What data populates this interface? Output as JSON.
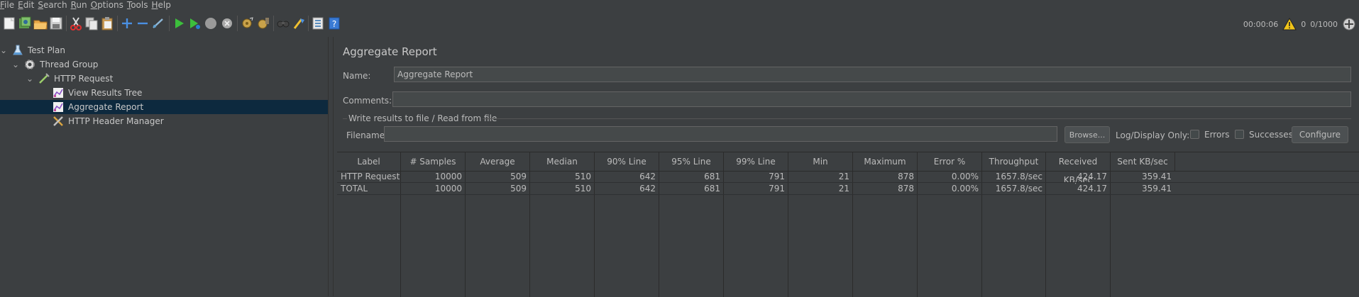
{
  "menu": [
    {
      "u": "F",
      "rest": "ile"
    },
    {
      "u": "E",
      "rest": "dit"
    },
    {
      "u": "S",
      "rest": "earch"
    },
    {
      "u": "R",
      "rest": "un"
    },
    {
      "u": "O",
      "rest": "ptions"
    },
    {
      "u": "T",
      "rest": "ools"
    },
    {
      "u": "H",
      "rest": "elp"
    }
  ],
  "toolbar_icons": [
    "new-icon",
    "templates-icon",
    "open-icon",
    "save-icon",
    "cut-icon",
    "copy-icon",
    "paste-icon",
    "expand-icon",
    "collapse-icon",
    "toggle-icon",
    "start-icon",
    "start-no-pauses-icon",
    "stop-icon",
    "shutdown-icon",
    "clear-icon",
    "clear-all-icon",
    "search-icon",
    "reset-search-icon",
    "function-helper-icon",
    "help-icon"
  ],
  "status": {
    "elapsed": "00:00:06",
    "warnings": "0",
    "threads": "0/1000"
  },
  "tree": [
    {
      "label": "Test Plan",
      "icon": "flask-icon",
      "caret": "v"
    },
    {
      "label": "Thread Group",
      "icon": "gear-icon",
      "caret": "v"
    },
    {
      "label": "HTTP Request",
      "icon": "pipette-icon",
      "caret": "v"
    },
    {
      "label": "View Results Tree",
      "icon": "chart-icon",
      "caret": ""
    },
    {
      "label": "Aggregate Report",
      "icon": "chart-icon",
      "caret": ""
    },
    {
      "label": "HTTP Header Manager",
      "icon": "tools-icon",
      "caret": ""
    }
  ],
  "panel": {
    "title": "Aggregate Report",
    "name_label": "Name:",
    "name_value": "Aggregate Report",
    "comments_label": "Comments:",
    "comments_value": "",
    "file_group_label": "Write results to file / Read from file",
    "filename_label": "Filename",
    "filename_value": "",
    "browse_label": "Browse...",
    "log_display_label": "Log/Display Only:",
    "errors_label": "Errors",
    "successes_label": "Successes",
    "configure_label": "Configure"
  },
  "table": {
    "columns": [
      "Label",
      "# Samples",
      "Average",
      "Median",
      "90% Line",
      "95% Line",
      "99% Line",
      "Min",
      "Maximum",
      "Error %",
      "Throughput",
      "Received KB/sec",
      "Sent KB/sec"
    ],
    "rows": [
      [
        "HTTP Request",
        "10000",
        "509",
        "510",
        "642",
        "681",
        "791",
        "21",
        "878",
        "0.00%",
        "1657.8/sec",
        "424.17",
        "359.41"
      ],
      [
        "TOTAL",
        "10000",
        "509",
        "510",
        "642",
        "681",
        "791",
        "21",
        "878",
        "0.00%",
        "1657.8/sec",
        "424.17",
        "359.41"
      ]
    ]
  }
}
